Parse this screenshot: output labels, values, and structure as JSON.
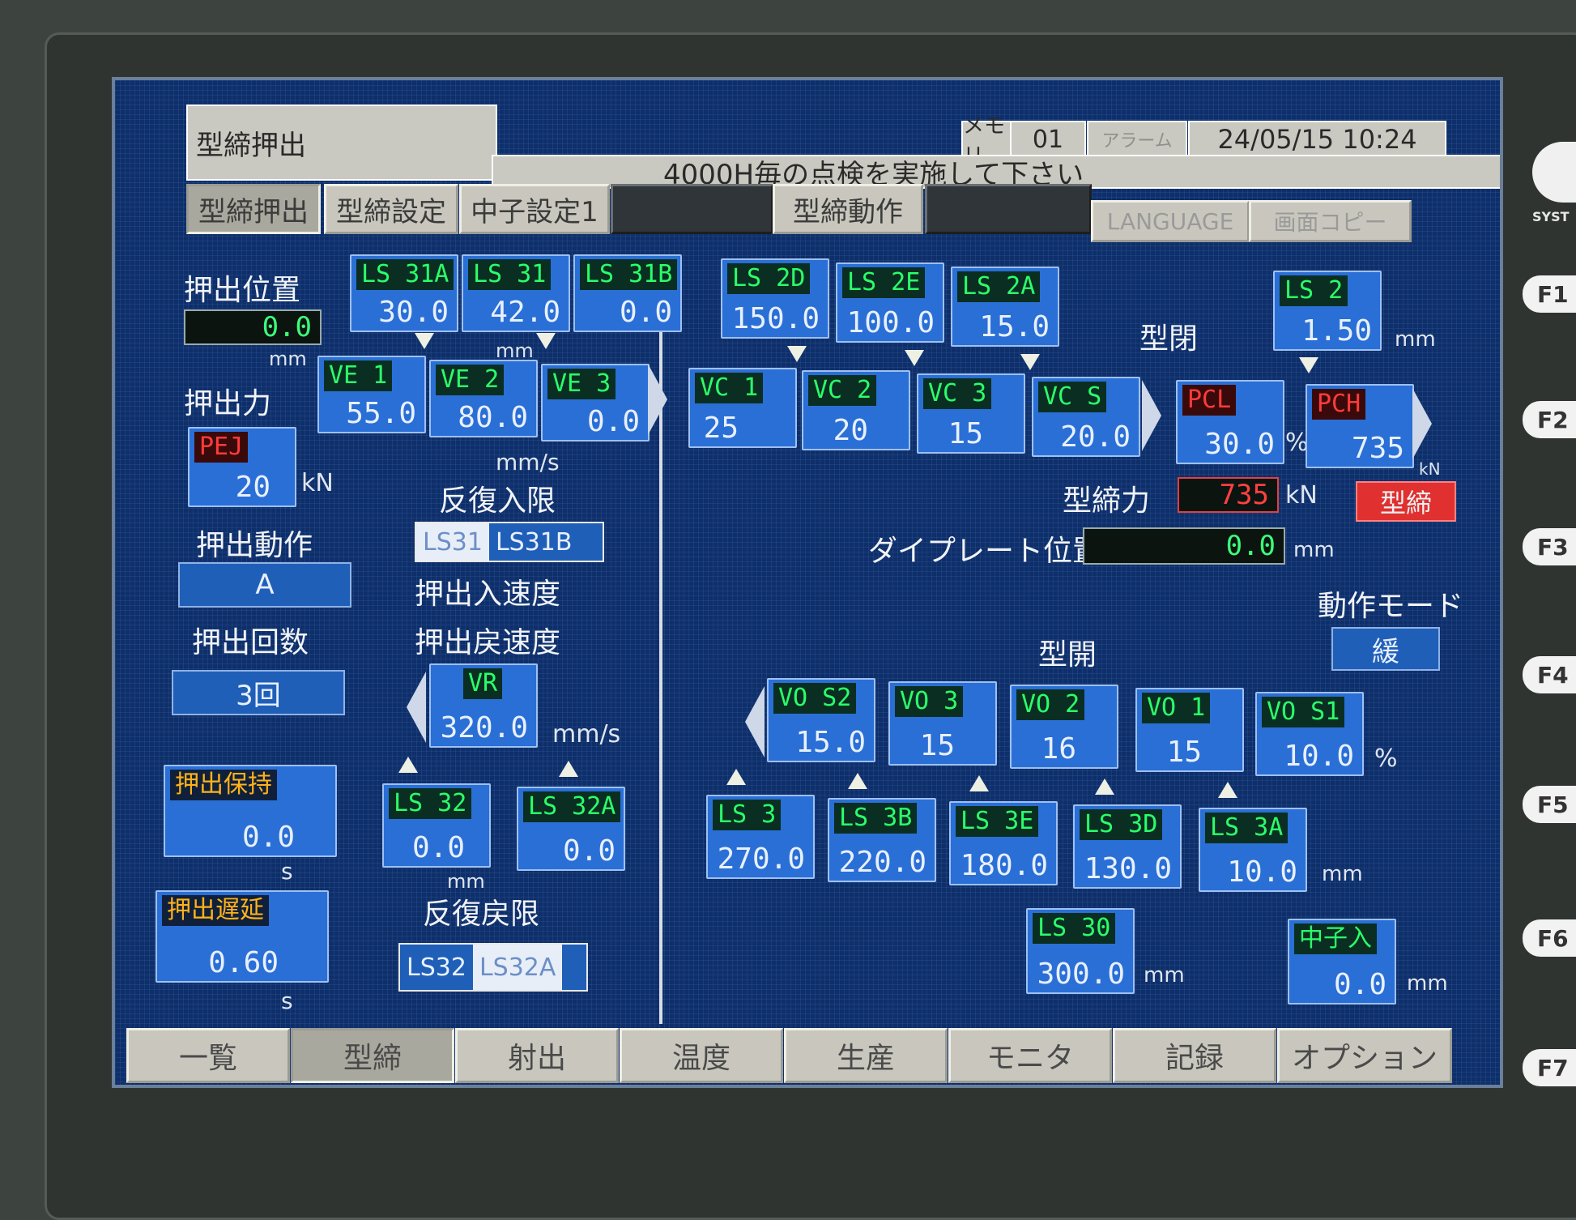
{
  "header": {
    "screen_title": "型締押出",
    "memory_label": "メモリ",
    "memory_value": "01",
    "alarm_label": "アラーム",
    "datetime": "24/05/15 10:24",
    "message": "4000H毎の点検を実施して下さい"
  },
  "top_tabs": [
    "型締押出",
    "型締設定",
    "中子設定1",
    "型締動作",
    "LANGUAGE",
    "画面コピー"
  ],
  "bottom_tabs": [
    "一覧",
    "型締",
    "射出",
    "温度",
    "生産",
    "モニタ",
    "記録",
    "オプション"
  ],
  "fkeys": [
    "F1",
    "F2",
    "F3",
    "F4",
    "F5",
    "F6",
    "F7"
  ],
  "system_label": "SYST",
  "left": {
    "eject_pos_label": "押出位置",
    "eject_pos_value": "0.0",
    "mm1": "mm",
    "eject_force_label": "押出力",
    "pej_tag": "PEJ",
    "pej_value": "20",
    "kn1": "kN",
    "eject_action_label": "押出動作",
    "eject_action_value": "A",
    "eject_count_label": "押出回数",
    "eject_count_value": "3回",
    "eject_hold_label": "押出保持",
    "eject_hold_value": "0.0",
    "s1": "s",
    "eject_delay_label": "押出遅延",
    "eject_delay_value": "0.60",
    "s2": "s",
    "ls31a": {
      "tag": "LS 31A",
      "value": "30.0"
    },
    "ls31": {
      "tag": "LS 31",
      "value": "42.0"
    },
    "ls31b": {
      "tag": "LS 31B",
      "value": "0.0"
    },
    "mm2": "mm",
    "ve1": {
      "tag": "VE 1",
      "value": "55.0"
    },
    "ve2": {
      "tag": "VE 2",
      "value": "80.0"
    },
    "ve3": {
      "tag": "VE 3",
      "value": "0.0"
    },
    "mms1": "mm/s",
    "repeat_in_label": "反復入限",
    "repeat_in_a": "LS31",
    "repeat_in_b": "LS31B",
    "in_speed_label": "押出入速度",
    "back_speed_label": "押出戻速度",
    "vr": {
      "tag": "VR",
      "value": "320.0"
    },
    "mms2": "mm/s",
    "ls32": {
      "tag": "LS 32",
      "value": "0.0"
    },
    "ls32a": {
      "tag": "LS 32A",
      "value": "0.0"
    },
    "mm3": "mm",
    "repeat_back_label": "反復戻限",
    "repeat_back_a": "LS32",
    "repeat_back_b": "LS32A"
  },
  "right": {
    "ls2d": {
      "tag": "LS 2D",
      "value": "150.0"
    },
    "ls2e": {
      "tag": "LS 2E",
      "value": "100.0"
    },
    "ls2a": {
      "tag": "LS 2A",
      "value": "15.0"
    },
    "mold_close_label": "型閉",
    "ls2": {
      "tag": "LS 2",
      "value": "1.50"
    },
    "mm4": "mm",
    "vc1": {
      "tag": "VC 1",
      "value": "25"
    },
    "vc2": {
      "tag": "VC 2",
      "value": "20"
    },
    "vc3": {
      "tag": "VC 3",
      "value": "15"
    },
    "vcs": {
      "tag": "VC S",
      "value": "20.0"
    },
    "pcl": {
      "tag": "PCL",
      "value": "30.0"
    },
    "pct": "%",
    "pch": {
      "tag": "PCH",
      "value": "735"
    },
    "kn2": "kN",
    "clamp_force_label": "型締力",
    "clamp_force_value": "735",
    "kn3": "kN",
    "clamp_status": "型締",
    "die_plate_label": "ダイプレート位置",
    "die_plate_value": "0.0",
    "mm5": "mm",
    "op_mode_label": "動作モード",
    "op_mode_value": "緩",
    "mold_open_label": "型開",
    "vos2": {
      "tag": "VO S2",
      "value": "15.0"
    },
    "vo3": {
      "tag": "VO 3",
      "value": "15"
    },
    "vo2": {
      "tag": "VO 2",
      "value": "16"
    },
    "vo1": {
      "tag": "VO 1",
      "value": "15"
    },
    "vos1": {
      "tag": "VO S1",
      "value": "10.0"
    },
    "pct2": "%",
    "ls3": {
      "tag": "LS 3",
      "value": "270.0"
    },
    "ls3b": {
      "tag": "LS 3B",
      "value": "220.0"
    },
    "ls3e": {
      "tag": "LS 3E",
      "value": "180.0"
    },
    "ls3d": {
      "tag": "LS 3D",
      "value": "130.0"
    },
    "ls3a": {
      "tag": "LS 3A",
      "value": "10.0"
    },
    "mm6": "mm",
    "ls30": {
      "tag": "LS 30",
      "value": "300.0"
    },
    "mm7": "mm",
    "core_in": {
      "tag": "中子入",
      "value": "0.0"
    },
    "mm8": "mm"
  },
  "colors": {
    "screen": "#0f2f6a",
    "box": "#2a6fd6",
    "tag_green": "#2bff6a",
    "alarm_red": "#ff3b3b"
  }
}
